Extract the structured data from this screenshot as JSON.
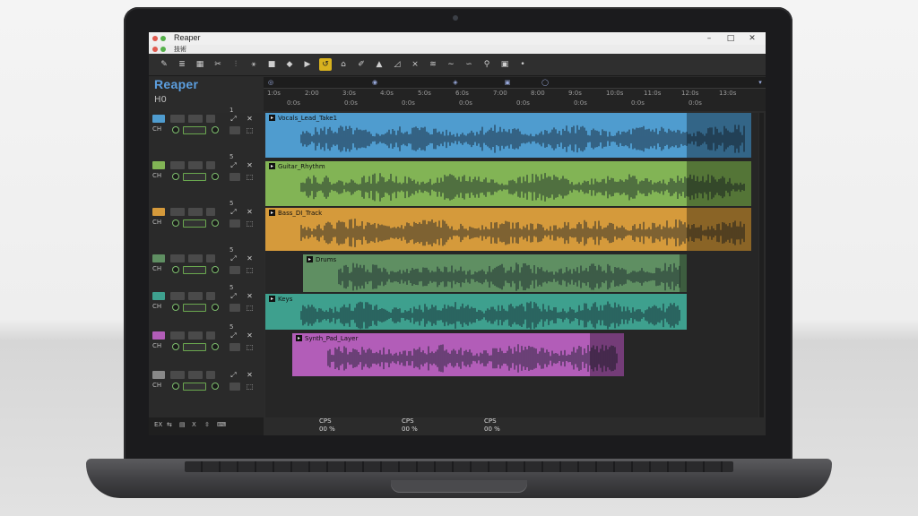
{
  "window": {
    "title": "Reaper",
    "menu_text": "技術",
    "min_glyph": "–",
    "max_glyph": "□",
    "close_glyph": "✕",
    "dot_colors": [
      "#e05a4f",
      "#55b04a",
      "#e3b23c"
    ]
  },
  "app": {
    "logo": "Reaper",
    "hz": "H0"
  },
  "toolbar": {
    "icons": [
      "pencil-icon",
      "brush-icon",
      "grid-icon",
      "cut-icon",
      "split-icon",
      "fx-icon",
      "stop-icon",
      "record-icon",
      "play-icon",
      "loop-icon",
      "home-icon",
      "marker-icon",
      "bird-icon",
      "envelope-icon",
      "crossfade-icon",
      "wave-icon",
      "tilde-icon",
      "route-icon",
      "snap-icon",
      "metronome-icon",
      "dot-icon"
    ],
    "glyphs": [
      "✎",
      "≣",
      "▦",
      "✂",
      "⫶",
      "⚹",
      "■",
      "◆",
      "▶",
      "↺",
      "⌂",
      "✐",
      "▲",
      "◿",
      "⨯",
      "≋",
      "∼",
      "∽",
      "⚲",
      "▣",
      "•"
    ],
    "active_index": 9,
    "accent": "#d8b21e"
  },
  "timeline": {
    "markers": [
      "◎",
      "◉",
      "◈",
      "▣",
      "◯",
      "▾"
    ],
    "labels": [
      "1:0s",
      "2:00",
      "3:0s",
      "4:0s",
      "5:0s",
      "6:0s",
      "7:00",
      "8:00",
      "9:0s",
      "10:0s",
      "11:0s",
      "12:0s",
      "13:0s"
    ],
    "sublabels": [
      "0:0s",
      "0:0s",
      "0:0s",
      "0:0s",
      "0:0s",
      "0:0s",
      "0:0s",
      "0:0s"
    ]
  },
  "tracks": [
    {
      "label": "Vocals_Lead_Take1",
      "color": "#4f9ccf",
      "type": "vocal"
    },
    {
      "label": "Guitar_Rhythm",
      "color": "#82b455",
      "type": "guitar"
    },
    {
      "label": "Bass_DI_Track",
      "color": "#d59a3b",
      "type": "bass"
    },
    {
      "label": "Drums",
      "color": "#5f8f62",
      "type": "drums"
    },
    {
      "label": "Keys",
      "color": "#3ea08e",
      "type": "keys"
    },
    {
      "label": "Synth_Pad_Layer",
      "color": "#b25db8",
      "type": "synth"
    }
  ],
  "track_controls": {
    "num_labels": [
      "1",
      "5",
      "5",
      "5",
      "5",
      "5"
    ],
    "sub_labels": [
      "CH",
      "CH",
      "CH",
      "CH",
      "CH",
      "CH",
      "CH"
    ],
    "knob_glyph": "◉"
  },
  "meters": [
    {
      "label": "CPS",
      "value": "00 %",
      "fill": 0.55,
      "color": "#7fbf4f"
    },
    {
      "label": "CPS",
      "value": "00 %",
      "fill": 0.7,
      "color": "#3bb08f"
    },
    {
      "label": "CPS",
      "value": "00 %",
      "fill": 0.4,
      "color": "#a25dd0"
    }
  ],
  "status": {
    "items": [
      "EX",
      "⇆",
      "▤",
      "X",
      "⇳",
      "⌨"
    ]
  }
}
